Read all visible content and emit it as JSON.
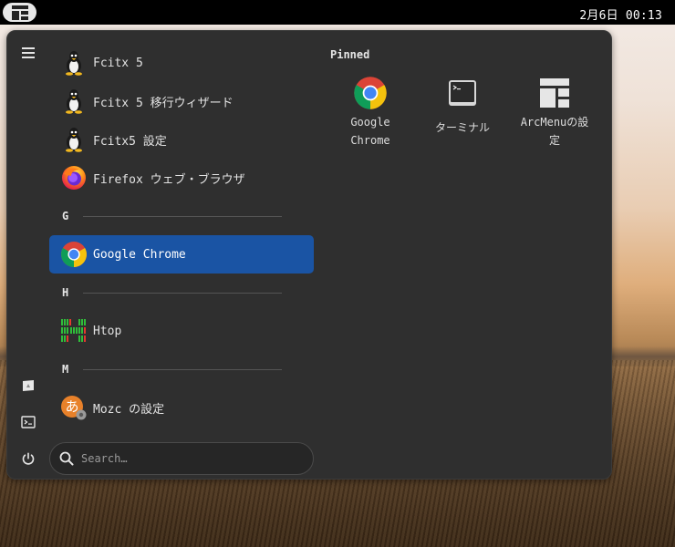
{
  "topbar": {
    "clock": "2月6日 00:13"
  },
  "apps": [
    {
      "label": "Fcitx 5",
      "icon": "tux-icon"
    },
    {
      "label": "Fcitx 5 移行ウィザード",
      "icon": "tux-icon"
    },
    {
      "label": "Fcitx5 設定",
      "icon": "tux-icon"
    },
    {
      "label": "Firefox ウェブ・ブラウザ",
      "icon": "firefox-icon"
    },
    {
      "section": "G"
    },
    {
      "label": "Google Chrome",
      "icon": "chrome-icon",
      "selected": true
    },
    {
      "section": "H"
    },
    {
      "label": "Htop",
      "icon": "htop-icon"
    },
    {
      "section": "M"
    },
    {
      "label": "Mozc の設定",
      "icon": "mozc-icon"
    }
  ],
  "search": {
    "placeholder": "Search…"
  },
  "pinned": {
    "title": "Pinned",
    "items": [
      {
        "label": "Google Chrome",
        "icon": "chrome-icon"
      },
      {
        "label": "ターミナル",
        "icon": "terminal-icon"
      },
      {
        "label": "ArcMenuの設定",
        "icon": "arcmenu-icon"
      }
    ]
  },
  "colors": {
    "selected": "#1a54a4",
    "panel": "#2f2f2f"
  }
}
